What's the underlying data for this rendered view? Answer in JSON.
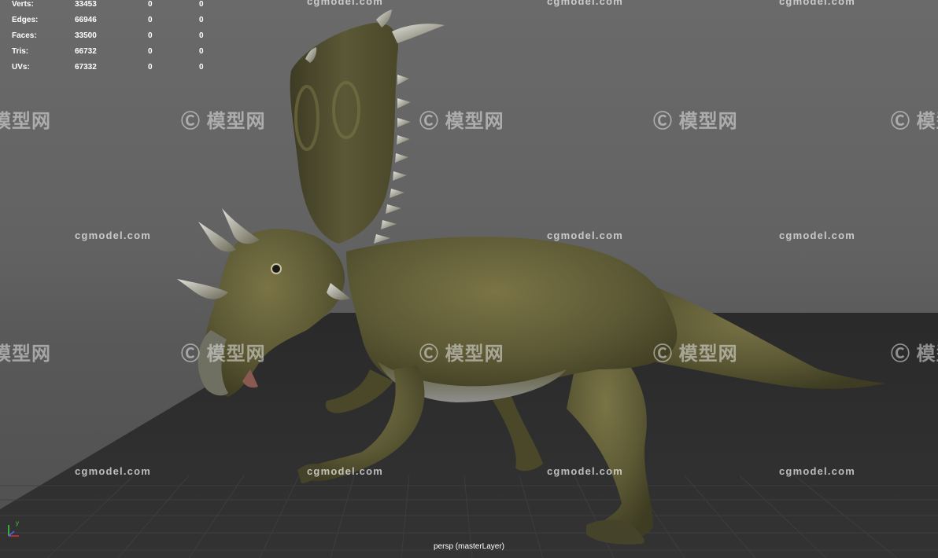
{
  "stats": {
    "rows": [
      {
        "label": "Verts:",
        "total": "33453",
        "selected": "0",
        "tri_selected": "0"
      },
      {
        "label": "Edges:",
        "total": "66946",
        "selected": "0",
        "tri_selected": "0"
      },
      {
        "label": "Faces:",
        "total": "33500",
        "selected": "0",
        "tri_selected": "0"
      },
      {
        "label": "Tris:",
        "total": "66732",
        "selected": "0",
        "tri_selected": "0"
      },
      {
        "label": "UVs:",
        "total": "67332",
        "selected": "0",
        "tri_selected": "0"
      }
    ]
  },
  "viewport": {
    "camera_label": "persp (masterLayer)",
    "axis_y_label": "y"
  },
  "watermarks": {
    "site": "cgmodel.com",
    "logo": "模型网"
  },
  "colors": {
    "background": "#626262",
    "ground": "#2f2f2f",
    "grid": "#3e3e3e",
    "dino_body": "#5b5a34",
    "dino_belly": "#8a8a88",
    "horn": "#c9c9c4"
  }
}
